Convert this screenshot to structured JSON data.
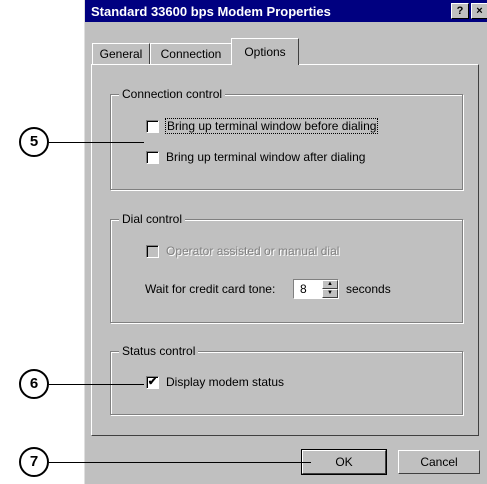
{
  "window": {
    "title": "Standard 33600 bps Modem Properties",
    "help_glyph": "?",
    "close_glyph": "×"
  },
  "tabs": [
    {
      "label": "General",
      "selected": false
    },
    {
      "label": "Connection",
      "selected": false
    },
    {
      "label": "Options",
      "selected": true
    }
  ],
  "connection_control": {
    "label": "Connection control",
    "before_dialing": {
      "label": "Bring up terminal window before dialing",
      "checked": false
    },
    "after_dialing": {
      "label": "Bring up terminal window after dialing",
      "checked": false
    }
  },
  "dial_control": {
    "label": "Dial control",
    "operator_assisted": {
      "label": "Operator assisted or manual dial",
      "checked": false,
      "enabled": false
    },
    "wait_label": "Wait for credit card tone:",
    "wait_value": "8",
    "wait_unit": "seconds"
  },
  "status_control": {
    "label": "Status control",
    "display_status": {
      "label": "Display modem status",
      "checked": true,
      "mark": "✔"
    }
  },
  "buttons": {
    "ok": "OK",
    "cancel": "Cancel"
  },
  "callouts": [
    "5",
    "6",
    "7"
  ],
  "colors": {
    "titlebar": "#000080",
    "dialog_face": "#c0c0c0"
  }
}
